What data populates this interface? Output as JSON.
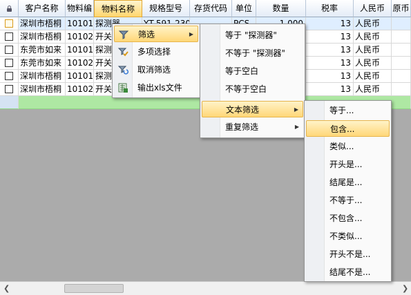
{
  "header": {
    "columns": [
      "客户名称",
      "物料编",
      "物料名称",
      "规格型号",
      "存货代码",
      "单位",
      "数量",
      "税率",
      "人民币",
      "原币"
    ]
  },
  "rows": [
    {
      "customer": "深圳市梧桐",
      "code": "10101C",
      "name": "探测器",
      "spec": "YT-591-230",
      "unit": "PCS",
      "qty": "1.000",
      "tax": "13",
      "currency": "人民币"
    },
    {
      "customer": "深圳市梧桐",
      "code": "10102C",
      "name": "开关",
      "spec": "",
      "unit": "",
      "qty": "",
      "tax": "13",
      "currency": "人民币"
    },
    {
      "customer": "东莞市如来",
      "code": "10101C",
      "name": "探测",
      "spec": "",
      "unit": "",
      "qty": "",
      "tax": "13",
      "currency": "人民币"
    },
    {
      "customer": "东莞市如来",
      "code": "10102C",
      "name": "开关",
      "spec": "",
      "unit": "",
      "qty": "",
      "tax": "13",
      "currency": "人民币"
    },
    {
      "customer": "深圳市梧桐",
      "code": "10101C",
      "name": "探测",
      "spec": "",
      "unit": "",
      "qty": "",
      "tax": "13",
      "currency": "人民币"
    },
    {
      "customer": "深圳市梧桐",
      "code": "10102C",
      "name": "开关",
      "spec": "",
      "unit": "",
      "qty": "",
      "tax": "13",
      "currency": "人民币"
    }
  ],
  "context_menu": {
    "items": [
      "筛选",
      "多项选择",
      "取消筛选",
      "输出xls文件"
    ]
  },
  "filter_menu": {
    "items": [
      "等于 \"探测器\"",
      "不等于 \"探测器\"",
      "等于空白",
      "不等于空白",
      "文本筛选",
      "重复筛选"
    ]
  },
  "text_filter_menu": {
    "items": [
      "等于...",
      "包含...",
      "类似...",
      "开头是...",
      "结尾是...",
      "不等于...",
      "不包含...",
      "不类似...",
      "开头不是...",
      "结尾不是..."
    ]
  },
  "colors": {
    "highlight": "#ffd778",
    "new_row": "#aee8a3",
    "header": "#e4ecf7"
  }
}
